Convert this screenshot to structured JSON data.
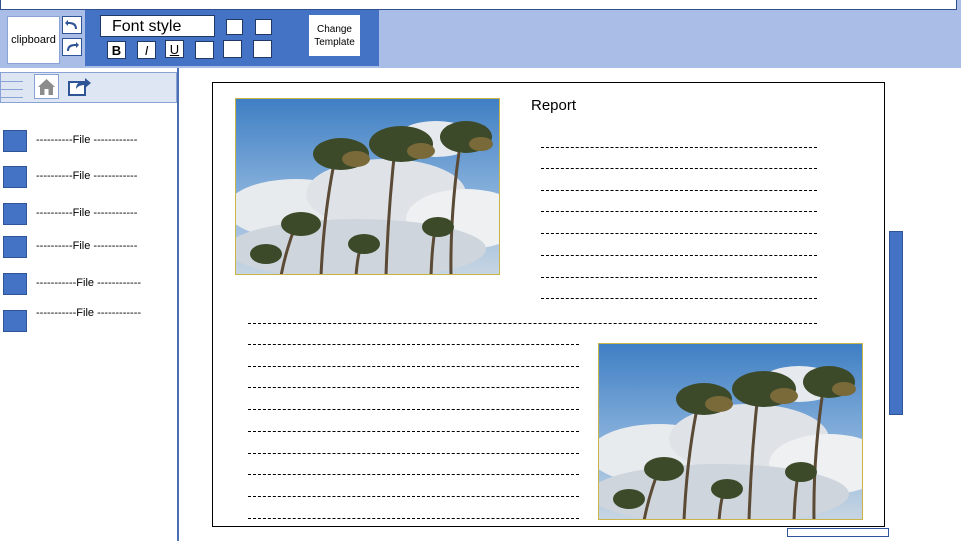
{
  "ribbon": {
    "clipboard_label": "clipboard",
    "font_style_label": "Font style",
    "bold_label": "B",
    "italic_label": "I",
    "underline_label": "U",
    "change_template_label": "Change\nTemplate"
  },
  "files": [
    {
      "label": "----------File ------------"
    },
    {
      "label": "----------File ------------"
    },
    {
      "label": "----------File ------------"
    },
    {
      "label": "----------File ------------"
    },
    {
      "label": "-----------File ------------"
    },
    {
      "label": "-----------File ------------"
    }
  ],
  "document": {
    "title": "Report"
  },
  "icons": {
    "undo": "undo-icon",
    "redo": "redo-icon",
    "menu": "hamburger-icon",
    "home": "home-icon",
    "share": "share-icon",
    "file": "file-icon",
    "photo": "palm-trees-image"
  },
  "colors": {
    "accent": "#4472c4",
    "ribbon": "#a9bde6"
  }
}
